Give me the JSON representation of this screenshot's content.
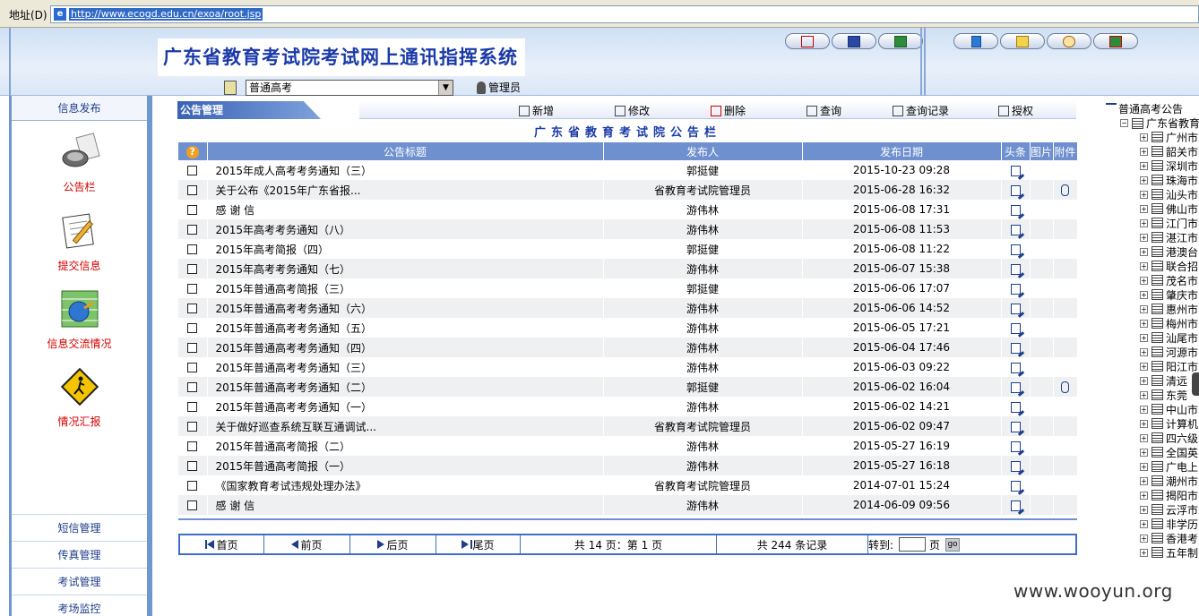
{
  "address_bar": {
    "label": "地址(D)",
    "url": "http://www.ecogd.edu.cn/exoa/root.jsp"
  },
  "header": {
    "title": "广东省教育考试院考试网上通讯指挥系统",
    "exam_select": "普通高考",
    "user": "管理员",
    "toolbar_icons": [
      "home-icon",
      "word-icon",
      "excel-icon",
      "book-icon",
      "mail-icon",
      "clock-icon",
      "exit-icon"
    ]
  },
  "sidebar": {
    "header": "信息发布",
    "items": [
      {
        "label": "公告栏",
        "icon": "megaphone-icon"
      },
      {
        "label": "提交信息",
        "icon": "notepad-pencil-icon"
      },
      {
        "label": "信息交流情况",
        "icon": "globe-exchange-icon"
      },
      {
        "label": "情况汇报",
        "icon": "warning-sign-icon"
      }
    ],
    "bottom_items": [
      "短信管理",
      "传真管理",
      "考试管理",
      "考场监控"
    ]
  },
  "main": {
    "section_title": "公告管理",
    "actions": [
      "新增",
      "修改",
      "删除",
      "查询",
      "查询记录",
      "授权"
    ],
    "board_title": "广东省教育考试院公告栏",
    "columns": [
      "公告标题",
      "发布人",
      "发布日期",
      "头条",
      "图片",
      "附件"
    ],
    "rows": [
      {
        "title": "2015年成人高考考务通知（三）",
        "publisher": "郭挺健",
        "date": "2015-10-23 09:28",
        "attach": false
      },
      {
        "title": "关于公布《2015年广东省报...",
        "publisher": "省教育考试院管理员",
        "date": "2015-06-28 16:32",
        "attach": true
      },
      {
        "title": "感 谢 信",
        "publisher": "游伟林",
        "date": "2015-06-08 17:31",
        "attach": false
      },
      {
        "title": "2015年高考考务通知（八）",
        "publisher": "游伟林",
        "date": "2015-06-08 11:53",
        "attach": false
      },
      {
        "title": "2015年高考简报（四）",
        "publisher": "郭挺健",
        "date": "2015-06-08 11:22",
        "attach": false
      },
      {
        "title": "2015年高考考务通知（七）",
        "publisher": "游伟林",
        "date": "2015-06-07 15:38",
        "attach": false
      },
      {
        "title": "2015年普通高考简报（三）",
        "publisher": "郭挺健",
        "date": "2015-06-06 17:07",
        "attach": false
      },
      {
        "title": "2015年普通高考考务通知（六）",
        "publisher": "游伟林",
        "date": "2015-06-06 14:52",
        "attach": false
      },
      {
        "title": "2015年普通高考考务通知（五）",
        "publisher": "游伟林",
        "date": "2015-06-05 17:21",
        "attach": false
      },
      {
        "title": "2015年普通高考考务通知（四）",
        "publisher": "游伟林",
        "date": "2015-06-04 17:46",
        "attach": false
      },
      {
        "title": "2015年普通高考考务通知（三）",
        "publisher": "游伟林",
        "date": "2015-06-03 09:22",
        "attach": false
      },
      {
        "title": "2015年普通高考考务通知（二）",
        "publisher": "郭挺健",
        "date": "2015-06-02 16:04",
        "attach": true
      },
      {
        "title": "2015年普通高考考务通知（一）",
        "publisher": "游伟林",
        "date": "2015-06-02 14:21",
        "attach": false
      },
      {
        "title": "关于做好巡查系统互联互通调试...",
        "publisher": "省教育考试院管理员",
        "date": "2015-06-02 09:47",
        "attach": false
      },
      {
        "title": "2015年普通高考简报（二）",
        "publisher": "游伟林",
        "date": "2015-05-27 16:19",
        "attach": false
      },
      {
        "title": "2015年普通高考简报（一）",
        "publisher": "游伟林",
        "date": "2015-05-27 16:18",
        "attach": false
      },
      {
        "title": "《国家教育考试违规处理办法》",
        "publisher": "省教育考试院管理员",
        "date": "2014-07-01 15:24",
        "attach": false
      },
      {
        "title": "感 谢 信",
        "publisher": "游伟林",
        "date": "2014-06-09 09:56",
        "attach": false
      }
    ],
    "pager": {
      "first": "首页",
      "prev": "前页",
      "next": "后页",
      "last": "尾页",
      "page_info": "共 14 页：第 1 页",
      "record_info": "共 244 条记录",
      "goto_label": "转到:",
      "page_unit": "页",
      "go": "go"
    }
  },
  "tree": {
    "root": "普通高考公告",
    "level1": "广东省教育",
    "nodes": [
      "广州市",
      "韶关市",
      "深圳市",
      "珠海市",
      "汕头市",
      "佛山市",
      "江门市",
      "湛江市",
      "港澳台",
      "联合招",
      "茂名市",
      "肇庆市",
      "惠州市",
      "梅州市",
      "汕尾市",
      "河源市",
      "阳江市",
      "清远",
      "东莞",
      "中山市",
      "计算机",
      "四六级",
      "全国英",
      "广电上",
      "潮州市",
      "揭阳市",
      "云浮市",
      "非学历",
      "香港考",
      "五年制"
    ]
  },
  "watermark": "www.wooyun.org"
}
